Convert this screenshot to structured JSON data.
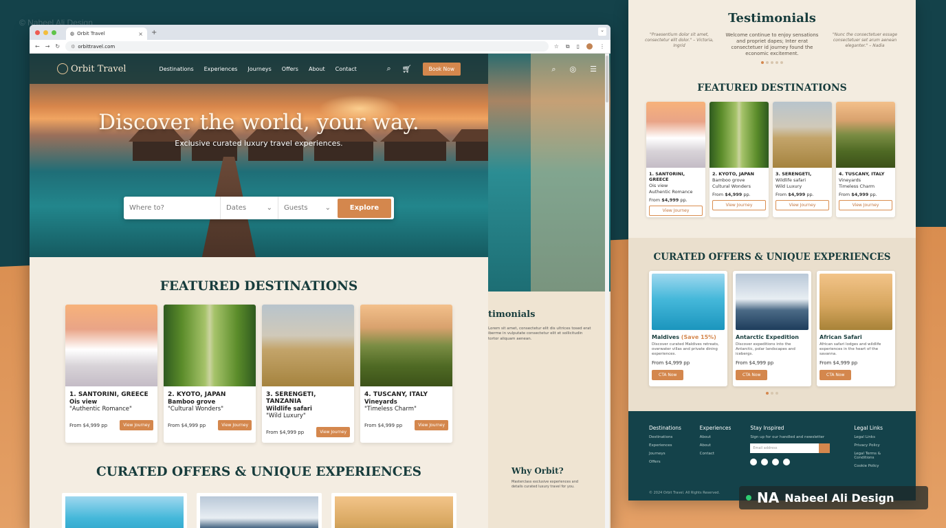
{
  "watermark_top": "© Nabeel Ali Design",
  "browser": {
    "tab_title": "Orbit Travel",
    "url": "orbittravel.com"
  },
  "nav": {
    "logo": "Orbit Travel",
    "items": [
      "Destinations",
      "Experiences",
      "Journeys",
      "Offers",
      "About",
      "Contact"
    ],
    "book_now": "Book Now"
  },
  "hero": {
    "title": "Discover the world, your way.",
    "subtitle": "Exclusive curated luxury travel experiences.",
    "search": {
      "where_placeholder": "Where to?",
      "dates_label": "Dates",
      "guests_label": "Guests",
      "explore_label": "Explore"
    }
  },
  "featured": {
    "heading": "FEATURED DESTINATIONS",
    "cards": [
      {
        "title": "1. SANTORINI, GREECE",
        "sub": "Ois view",
        "quote": "\"Authentic Romance\"",
        "price": "From $4,999 pp",
        "cta": "View Journey"
      },
      {
        "title": "2. KYOTO, JAPAN",
        "sub": "Bamboo grove",
        "quote": "\"Cultural Wonders\"",
        "price": "From $4,999 pp",
        "cta": "View Journey"
      },
      {
        "title": "3. SERENGETI, TANZANIA",
        "sub": "Wildlife safari",
        "quote": "\"Wild Luxury\"",
        "price": "From $4,999 pp",
        "cta": "View Journey"
      },
      {
        "title": "4. TUSCANY, ITALY",
        "sub": "Vineyards",
        "quote": "\"Timeless Charm\"",
        "price": "From $4,999 pp",
        "cta": "View Journey"
      }
    ]
  },
  "offers": {
    "heading": "CURATED OFFERS & UNIQUE EXPERIENCES"
  },
  "side": {
    "testimonials_partial": "timonials",
    "testimonial_text": "Lorem sit amet, consectetur elit dis ultrices tosed erat iberme in vulputate consectetur elit et sollicitudin tortor aliquam aenean.",
    "why_heading": "Why Orbit?",
    "why_text": "Masterclass exclusive experiences and details curated luxury travel for you."
  },
  "right_page": {
    "testimonials_heading": "Testimonials",
    "quote_left": "\"Praesentium dolor sit amet, consectetur elit dolor.\" – Victoria, Ingrid",
    "quote_center": "Welcome continue to enjoy sensations and propriet dapes; Inter erat consectetuer id journey found the economic excitement.",
    "quote_right": "\"Nunc the consectetuer essage consectetuer set arum aenean eleganter.\" – Nadia",
    "featured_heading": "FEATURED DESTINATIONS",
    "cards": [
      {
        "title": "1. SANTORINI, GREECE",
        "sub": "Ois view",
        "quote": "Authentic Romance",
        "price_label": "From",
        "price": "$4,999",
        "pp": "pp.",
        "cta": "View Journey"
      },
      {
        "title": "2. KYOTO, JAPAN",
        "sub": "Bamboo grove",
        "quote": "Cultural Wonders",
        "price_label": "From",
        "price": "$4,999",
        "pp": "pp.",
        "cta": "View Journey"
      },
      {
        "title": "3. SERENGETI, ",
        "sub": "Wildlife safari",
        "quote": "Wild Luxury",
        "price_label": "From",
        "price": "$4,999",
        "pp": "pp.",
        "cta": "View Journey"
      },
      {
        "title": "4. TUSCANY, ITALY",
        "sub": "Vineyards",
        "quote": "Timeless Charm",
        "price_label": "From",
        "price": "$4,999",
        "pp": "pp.",
        "cta": "View Journey"
      }
    ],
    "offers_heading": "CURATED OFFERS & UNIQUE EXPERIENCES",
    "offers": [
      {
        "title": "Maldives",
        "badge": "(Save 15%)",
        "desc": "Discover curated Maldives retreats, overwater villas and private dining experiences.",
        "price": "From $4,999 pp",
        "cta": "CTA Now"
      },
      {
        "title": "Antarctic Expedition",
        "badge": "",
        "desc": "Discover expeditions into the Antarctic, polar landscapes and icebergs.",
        "price": "From $4,999 pp",
        "cta": "CTA Now"
      },
      {
        "title": "African Safari",
        "badge": "",
        "desc": "African safari lodges and wildlife experiences in the heart of the savanna.",
        "price": "From $4,999 pp",
        "cta": "CTA Now"
      }
    ],
    "footer": {
      "cols": [
        {
          "heading": "Destinations",
          "links": [
            "Destinations",
            "Experiences",
            "Journeys",
            "Offers"
          ]
        },
        {
          "heading": "Experiences",
          "links": [
            "About",
            "About",
            "Contact"
          ]
        }
      ],
      "stay_inspired": "Stay Inspired",
      "newsletter_text": "Sign up for our handled and newsletter",
      "email_placeholder": "Email address",
      "legal_heading": "Legal Links",
      "legal_links": [
        "Legal Links",
        "Privacy Policy",
        "Legal Terms & Conditions",
        "Cookie Policy"
      ],
      "copyright": "© 2024 Orbit Travel. All Rights Reserved."
    }
  },
  "brand": {
    "initials": "NA",
    "name": "Nabeel Ali Design"
  }
}
